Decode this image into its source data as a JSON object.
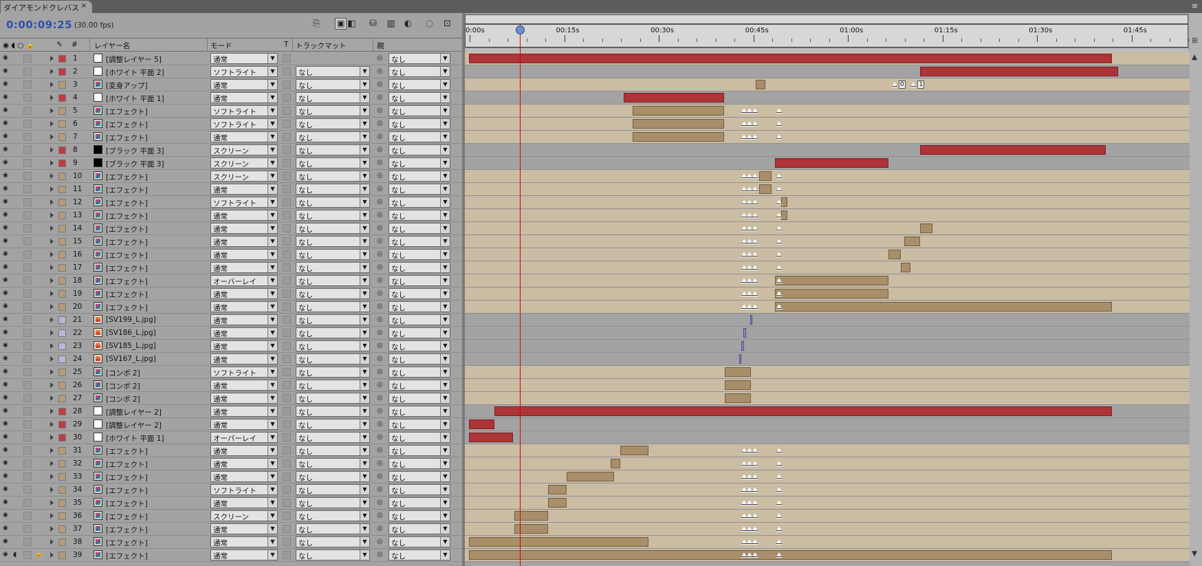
{
  "tab": {
    "title": "ダイアモンドクレバス",
    "close": "×",
    "menu": "≡"
  },
  "time": {
    "timecode": "0:00:09:25",
    "fps": "(30.00 fps)"
  },
  "toolbar": [
    "⎘",
    "▣",
    "◧",
    "⛁",
    "▥",
    "◐",
    "◌",
    "⊡"
  ],
  "headers": {
    "label": "#",
    "name": "レイヤー名",
    "mode": "モード",
    "t": "T",
    "matte": "トラックマット",
    "parent": "親"
  },
  "ruler": {
    "labels": [
      "0:00s",
      "00:15s",
      "00:30s",
      "00:45s",
      "01:00s",
      "01:15s",
      "01:30s",
      "01:45s"
    ]
  },
  "colors": {
    "red": "#ad3437",
    "tan": "#a88f6a",
    "lavender": "#8e8ac8",
    "timecode": "#2b4fb2",
    "playhead": "#d40000"
  },
  "playhead_time": "0:00:09:25",
  "layers": [
    {
      "n": "1",
      "name": "[調整レイヤー 5]",
      "mode": "通常",
      "matte": "",
      "parent": "なし",
      "icon": "solid-w",
      "label": "#c33b3f"
    },
    {
      "n": "2",
      "name": "[ホワイト 平面 2]",
      "mode": "ソフトライト",
      "matte": "なし",
      "parent": "なし",
      "icon": "solid-w",
      "label": "#c33b3f"
    },
    {
      "n": "3",
      "name": "[変身アップ]",
      "mode": "通常",
      "matte": "なし",
      "parent": "なし",
      "icon": "comp",
      "label": "#b79b77"
    },
    {
      "n": "4",
      "name": "[ホワイト 平面 1]",
      "mode": "通常",
      "matte": "なし",
      "parent": "なし",
      "icon": "solid-w",
      "label": "#c33b3f"
    },
    {
      "n": "5",
      "name": "[エフェクト]",
      "mode": "ソフトライト",
      "matte": "なし",
      "parent": "なし",
      "icon": "comp",
      "label": "#b79b77"
    },
    {
      "n": "6",
      "name": "[エフェクト]",
      "mode": "ソフトライト",
      "matte": "なし",
      "parent": "なし",
      "icon": "comp",
      "label": "#b79b77"
    },
    {
      "n": "7",
      "name": "[エフェクト]",
      "mode": "通常",
      "matte": "なし",
      "parent": "なし",
      "icon": "comp",
      "label": "#b79b77"
    },
    {
      "n": "8",
      "name": "[ブラック 平面 3]",
      "mode": "スクリーン",
      "matte": "なし",
      "parent": "なし",
      "icon": "solid-b",
      "label": "#c33b3f"
    },
    {
      "n": "9",
      "name": "[ブラック 平面 3]",
      "mode": "スクリーン",
      "matte": "なし",
      "parent": "なし",
      "icon": "solid-b",
      "label": "#c33b3f"
    },
    {
      "n": "10",
      "name": "[エフェクト]",
      "mode": "スクリーン",
      "matte": "なし",
      "parent": "なし",
      "icon": "comp",
      "label": "#b79b77"
    },
    {
      "n": "11",
      "name": "[エフェクト]",
      "mode": "通常",
      "matte": "なし",
      "parent": "なし",
      "icon": "comp",
      "label": "#b79b77"
    },
    {
      "n": "12",
      "name": "[エフェクト]",
      "mode": "ソフトライト",
      "matte": "なし",
      "parent": "なし",
      "icon": "comp",
      "label": "#b79b77"
    },
    {
      "n": "13",
      "name": "[エフェクト]",
      "mode": "通常",
      "matte": "なし",
      "parent": "なし",
      "icon": "comp",
      "label": "#b79b77"
    },
    {
      "n": "14",
      "name": "[エフェクト]",
      "mode": "通常",
      "matte": "なし",
      "parent": "なし",
      "icon": "comp",
      "label": "#b79b77"
    },
    {
      "n": "15",
      "name": "[エフェクト]",
      "mode": "通常",
      "matte": "なし",
      "parent": "なし",
      "icon": "comp",
      "label": "#b79b77"
    },
    {
      "n": "16",
      "name": "[エフェクト]",
      "mode": "通常",
      "matte": "なし",
      "parent": "なし",
      "icon": "comp",
      "label": "#b79b77"
    },
    {
      "n": "17",
      "name": "[エフェクト]",
      "mode": "通常",
      "matte": "なし",
      "parent": "なし",
      "icon": "comp",
      "label": "#b79b77"
    },
    {
      "n": "18",
      "name": "[エフェクト]",
      "mode": "オーバーレイ",
      "matte": "なし",
      "parent": "なし",
      "icon": "comp",
      "label": "#b79b77"
    },
    {
      "n": "19",
      "name": "[エフェクト]",
      "mode": "通常",
      "matte": "なし",
      "parent": "なし",
      "icon": "comp",
      "label": "#b79b77"
    },
    {
      "n": "20",
      "name": "[エフェクト]",
      "mode": "通常",
      "matte": "なし",
      "parent": "なし",
      "icon": "comp",
      "label": "#b79b77"
    },
    {
      "n": "21",
      "name": "[SV199_L.jpg]",
      "mode": "通常",
      "matte": "なし",
      "parent": "なし",
      "icon": "img",
      "label": "#b7b6dc"
    },
    {
      "n": "22",
      "name": "[SV186_L.jpg]",
      "mode": "通常",
      "matte": "なし",
      "parent": "なし",
      "icon": "img",
      "label": "#b7b6dc"
    },
    {
      "n": "23",
      "name": "[SV185_L.jpg]",
      "mode": "通常",
      "matte": "なし",
      "parent": "なし",
      "icon": "img",
      "label": "#b7b6dc"
    },
    {
      "n": "24",
      "name": "[SV167_L.jpg]",
      "mode": "通常",
      "matte": "なし",
      "parent": "なし",
      "icon": "img",
      "label": "#b7b6dc"
    },
    {
      "n": "25",
      "name": "[コンポ 2]",
      "mode": "ソフトライト",
      "matte": "なし",
      "parent": "なし",
      "icon": "comp",
      "label": "#b79b77"
    },
    {
      "n": "26",
      "name": "[コンポ 2]",
      "mode": "通常",
      "matte": "なし",
      "parent": "なし",
      "icon": "comp",
      "label": "#b79b77"
    },
    {
      "n": "27",
      "name": "[コンポ 2]",
      "mode": "通常",
      "matte": "なし",
      "parent": "なし",
      "icon": "comp",
      "label": "#b79b77"
    },
    {
      "n": "28",
      "name": "[調整レイヤー 2]",
      "mode": "通常",
      "matte": "なし",
      "parent": "なし",
      "icon": "solid-w",
      "label": "#c33b3f"
    },
    {
      "n": "29",
      "name": "[調整レイヤー 2]",
      "mode": "通常",
      "matte": "なし",
      "parent": "なし",
      "icon": "solid-w",
      "label": "#c33b3f"
    },
    {
      "n": "30",
      "name": "[ホワイト 平面 1]",
      "mode": "オーバーレイ",
      "matte": "なし",
      "parent": "なし",
      "icon": "solid-w",
      "label": "#c33b3f"
    },
    {
      "n": "31",
      "name": "[エフェクト]",
      "mode": "通常",
      "matte": "なし",
      "parent": "なし",
      "icon": "comp",
      "label": "#b79b77"
    },
    {
      "n": "32",
      "name": "[エフェクト]",
      "mode": "通常",
      "matte": "なし",
      "parent": "なし",
      "icon": "comp",
      "label": "#b79b77"
    },
    {
      "n": "33",
      "name": "[エフェクト]",
      "mode": "通常",
      "matte": "なし",
      "parent": "なし",
      "icon": "comp",
      "label": "#b79b77"
    },
    {
      "n": "34",
      "name": "[エフェクト]",
      "mode": "ソフトライト",
      "matte": "なし",
      "parent": "なし",
      "icon": "comp",
      "label": "#b79b77"
    },
    {
      "n": "35",
      "name": "[エフェクト]",
      "mode": "通常",
      "matte": "なし",
      "parent": "なし",
      "icon": "comp",
      "label": "#b79b77"
    },
    {
      "n": "36",
      "name": "[エフェクト]",
      "mode": "スクリーン",
      "matte": "なし",
      "parent": "なし",
      "icon": "comp",
      "label": "#b79b77"
    },
    {
      "n": "37",
      "name": "[エフェクト]",
      "mode": "通常",
      "matte": "なし",
      "parent": "なし",
      "icon": "comp",
      "label": "#b79b77"
    },
    {
      "n": "38",
      "name": "[エフェクト]",
      "mode": "通常",
      "matte": "なし",
      "parent": "なし",
      "icon": "comp",
      "label": "#b79b77"
    },
    {
      "n": "39",
      "name": "[エフェクト]",
      "mode": "通常",
      "matte": "なし",
      "parent": "なし",
      "icon": "comp",
      "label": "#b79b77"
    }
  ],
  "marker_labels": [
    "0",
    "1"
  ]
}
